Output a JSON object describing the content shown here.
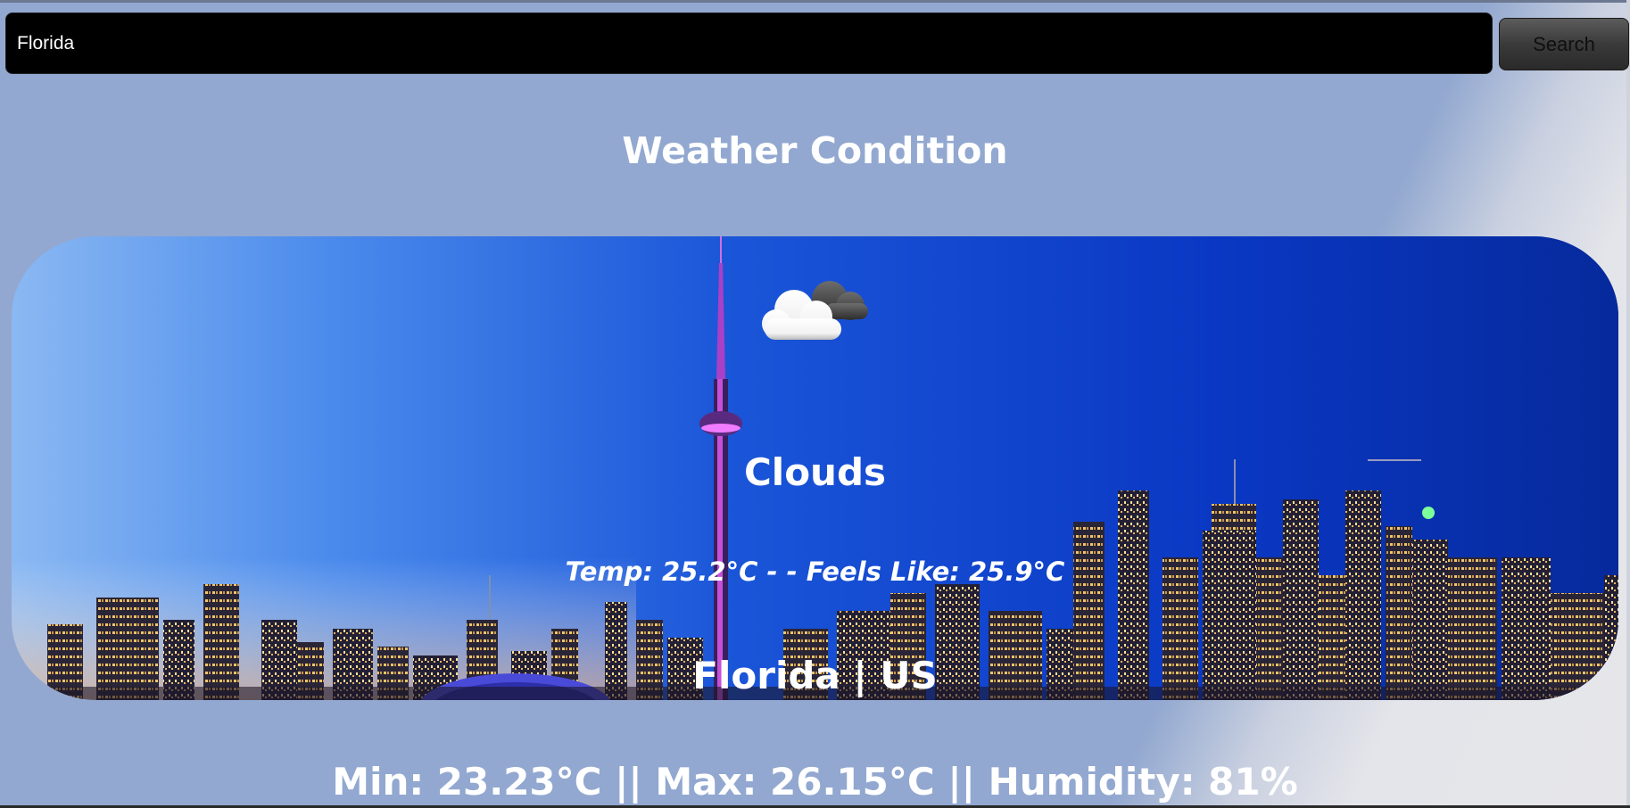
{
  "search": {
    "value": "Florida",
    "button_label": "Search"
  },
  "heading": "Weather Condition",
  "card": {
    "icon": "clouds-icon",
    "condition": "Clouds",
    "temp_line": "Temp: 25.2°C - - Feels Like: 25.9°C",
    "location": "Florida | US"
  },
  "stats_line": "Min: 23.23°C || Max: 26.15°C || Humidity: 81%",
  "colors": {
    "page_background": "#92a8d0",
    "search_background": "#000000",
    "text": "#ffffff"
  }
}
